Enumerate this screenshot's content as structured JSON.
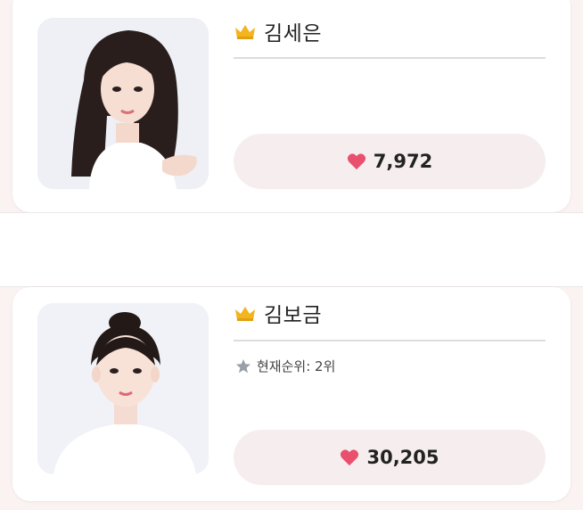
{
  "cards": [
    {
      "name": "김세은",
      "votes": "7,972",
      "rank_text": ""
    },
    {
      "name": "김보금",
      "votes": "30,205",
      "rank_text": "현재순위: 2위"
    }
  ],
  "colors": {
    "accent_heart": "#e8506e",
    "crown": "#f2b41f",
    "pill_bg": "#f6eeee",
    "page_bg": "#fbf2f2"
  },
  "icons": {
    "crown": "crown-icon",
    "heart": "heart-icon",
    "star": "star-icon"
  }
}
